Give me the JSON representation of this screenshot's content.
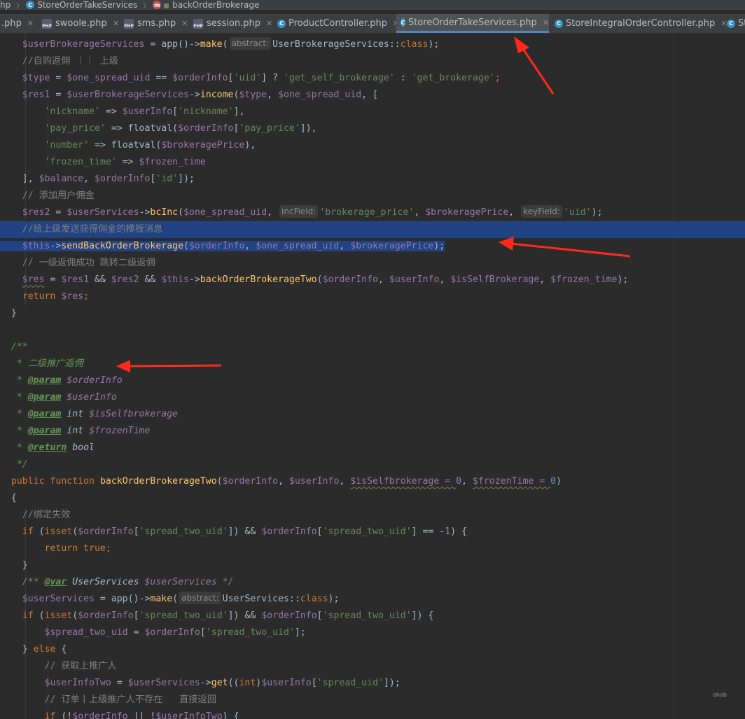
{
  "breadcrumb": {
    "items": [
      "hp",
      "StoreOrderTakeServices",
      "backOrderBrokerage"
    ],
    "icons": [
      "class-icon",
      "method-icon"
    ]
  },
  "tabs": [
    {
      "label": ".php",
      "icon": "php-file-icon"
    },
    {
      "label": "swoole.php",
      "icon": "php-file-icon"
    },
    {
      "label": "sms.php",
      "icon": "php-file-icon"
    },
    {
      "label": "session.php",
      "icon": "php-file-icon"
    },
    {
      "label": "ProductController.php",
      "icon": "class-icon"
    },
    {
      "label": "StoreOrderTakeServices.php",
      "icon": "class-icon",
      "active": true
    },
    {
      "label": "StoreIntegralOrderController.php",
      "icon": "class-icon"
    },
    {
      "label": "St",
      "icon": "class-icon"
    }
  ],
  "code": {
    "hint_abstract": "abstract:",
    "hint_incfield": "incField:",
    "hint_keyfield": "keyField:",
    "l01a": "$userBrokerageServices",
    "l01b": " = app()->",
    "l01c": "make",
    "l01d": "(",
    "l01e": "UserBrokerageServices::",
    "l01f": "class",
    "l01g": ");",
    "l02": "//自购返佣 ｜｜ 上级",
    "l03a": "$type",
    "l03b": " = ",
    "l03c": "$one_spread_uid",
    "l03d": " == ",
    "l03e": "$orderInfo",
    "l03f": "[",
    "l03g": "'uid'",
    "l03h": "] ? ",
    "l03i": "'get_self_brokerage'",
    "l03j": " : ",
    "l03k": "'get_brokerage'",
    "l03l": ";",
    "l04a": "$res1",
    "l04b": " = ",
    "l04c": "$userBrokerageServices",
    "l04d": "->",
    "l04e": "income",
    "l04f": "(",
    "l04g": "$type",
    "l04h": ", ",
    "l04i": "$one_spread_uid",
    "l04j": ", [",
    "l05a": "'nickname'",
    "l05b": " => ",
    "l05c": "$userInfo",
    "l05d": "[",
    "l05e": "'nickname'",
    "l05f": "],",
    "l06a": "'pay_price'",
    "l06b": " => floatval(",
    "l06c": "$orderInfo",
    "l06d": "[",
    "l06e": "'pay_price'",
    "l06f": "]),",
    "l07a": "'number'",
    "l07b": " => floatval(",
    "l07c": "$brokeragePrice",
    "l07d": "),",
    "l08a": "'frozen_time'",
    "l08b": " => ",
    "l08c": "$frozen_time",
    "l09a": "], ",
    "l09b": "$balance",
    "l09c": ", ",
    "l09d": "$orderInfo",
    "l09e": "[",
    "l09f": "'id'",
    "l09g": "]);",
    "l10": "// 添加用户佣金",
    "l11a": "$res2",
    "l11b": " = ",
    "l11c": "$userServices",
    "l11d": "->",
    "l11e": "bcInc",
    "l11f": "(",
    "l11g": "$one_spread_uid",
    "l11h": ", ",
    "l11i": "'brokerage_price'",
    "l11j": ", ",
    "l11k": "$brokeragePrice",
    "l11l": ", ",
    "l11m": "'uid'",
    "l11n": ");",
    "l12": "//给上级发送获得佣金的模板消息",
    "l13a": "$this",
    "l13b": "->",
    "l13c": "sendBackOrderBrokerage",
    "l13d": "(",
    "l13e": "$orderInfo",
    "l13f": ", ",
    "l13g": "$one_spread_uid",
    "l13h": ", ",
    "l13i": "$brokeragePrice",
    "l13j": ");",
    "l14": "// 一级返佣成功 跳转二级返佣",
    "l15a": "$res",
    "l15b": " = ",
    "l15c": "$res1",
    "l15d": " && ",
    "l15e": "$res2",
    "l15f": " && ",
    "l15g": "$this",
    "l15h": "->",
    "l15i": "backOrderBrokerageTwo",
    "l15j": "(",
    "l15k": "$orderInfo",
    "l15l": ", ",
    "l15m": "$userInfo",
    "l15n": ", ",
    "l15o": "$isSelfBrokerage",
    "l15p": ", ",
    "l15q": "$frozen_time",
    "l15r": ");",
    "l16a": "return ",
    "l16b": "$res",
    "l16c": ";",
    "l17": "}",
    "l19": "/**",
    "l20a": " * ",
    "l20b": "二级推广返佣",
    "l21a": " * ",
    "l21b": "@param",
    "l21c": " ",
    "l21d": "$orderInfo",
    "l22a": " * ",
    "l22b": "@param",
    "l22c": " ",
    "l22d": "$userInfo",
    "l23a": " * ",
    "l23b": "@param",
    "l23c": " int ",
    "l23d": "$isSelfbrokerage",
    "l24a": " * ",
    "l24b": "@param",
    "l24c": " int ",
    "l24d": "$frozenTime",
    "l25a": " * ",
    "l25b": "@return",
    "l25c": " bool",
    "l26": " */",
    "l27a": "public function ",
    "l27b": "backOrderBrokerageTwo",
    "l27c": "(",
    "l27d": "$orderInfo",
    "l27e": ", ",
    "l27f": "$userInfo",
    "l27g": ", ",
    "l27h": "$isSelfbrokerage = ",
    "l27i": "0",
    "l27j": ", ",
    "l27k": "$frozenTime = ",
    "l27l": "0",
    "l27m": ")",
    "l28": "{",
    "l29": "//绑定失效",
    "l30a": "if ",
    "l30b": "(",
    "l30c": "isset",
    "l30d": "(",
    "l30e": "$orderInfo",
    "l30f": "[",
    "l30g": "'spread_two_uid'",
    "l30h": "]) && ",
    "l30i": "$orderInfo",
    "l30j": "[",
    "l30k": "'spread_two_uid'",
    "l30l": "] == -",
    "l30m": "1",
    "l30n": ") {",
    "l31a": "return ",
    "l31b": "true",
    "l31c": ";",
    "l32": "}",
    "l33a": "/** ",
    "l33b": "@var",
    "l33c": " UserServices ",
    "l33d": "$userServices",
    "l33e": " */",
    "l34a": "$userServices",
    "l34b": " = app()->",
    "l34c": "make",
    "l34d": "(",
    "l34e": "UserServices::",
    "l34f": "class",
    "l34g": ");",
    "l35a": "if ",
    "l35b": "(",
    "l35c": "isset",
    "l35d": "(",
    "l35e": "$orderInfo",
    "l35f": "[",
    "l35g": "'spread_two_uid'",
    "l35h": "]) && ",
    "l35i": "$orderInfo",
    "l35j": "[",
    "l35k": "'spread_two_uid'",
    "l35l": "]) {",
    "l36a": "$spread_two_uid",
    "l36b": " = ",
    "l36c": "$orderInfo",
    "l36d": "[",
    "l36e": "'spread_two_uid'",
    "l36f": "];",
    "l37a": "} ",
    "l37b": "else",
    "l37c": " {",
    "l38": "// 获取上推广人",
    "l39a": "$userInfoTwo",
    "l39b": " = ",
    "l39c": "$userServices",
    "l39d": "->",
    "l39e": "get",
    "l39f": "((",
    "l39g": "int",
    "l39h": ")",
    "l39i": "$userInfo",
    "l39j": "[",
    "l39k": "'spread_uid'",
    "l39l": "]);",
    "l40": "// 订单丨上级推广人不存在   直接返回",
    "l41a": "if ",
    "l41b": "(!",
    "l41c": "$orderInfo",
    "l41d": " || !",
    "l41e": "$userInfoTwo",
    "l41f": ") {"
  },
  "colors": {
    "background": "#2b2b2b",
    "selection": "#214283",
    "arrow": "#ff2a1a",
    "active_tab_underline": "#4a88c7"
  },
  "watermark": "ohob"
}
